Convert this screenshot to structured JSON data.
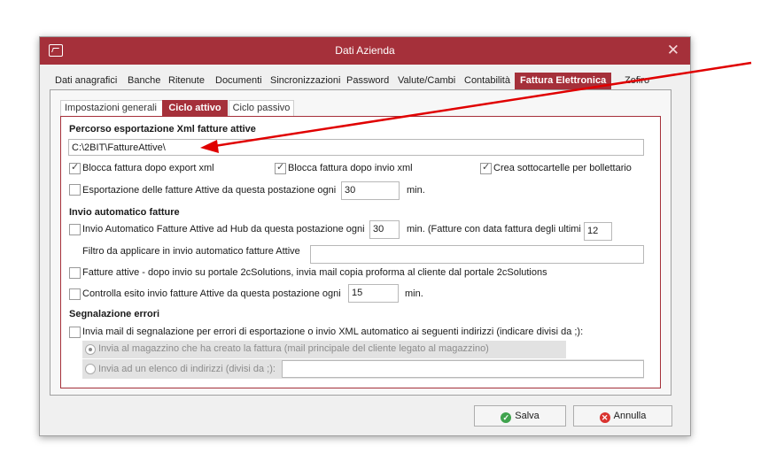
{
  "window": {
    "title": "Dati Azienda",
    "close_glyph": "✕",
    "title_bar_color": "#a5303a"
  },
  "main_tabs": [
    {
      "label": "Dati anagrafici"
    },
    {
      "label": "Banche"
    },
    {
      "label": "Ritenute"
    },
    {
      "label": "Documenti"
    },
    {
      "label": "Sincronizzazioni"
    },
    {
      "label": "Password"
    },
    {
      "label": "Valute/Cambi"
    },
    {
      "label": "Contabilità"
    },
    {
      "label": "Fattura Elettronica"
    },
    {
      "label": "Zefiro"
    }
  ],
  "sub_tabs": [
    {
      "label": "Impostazioni generali"
    },
    {
      "label": "Ciclo attivo"
    },
    {
      "label": "Ciclo passivo"
    }
  ],
  "export": {
    "header": "Percorso esportazione Xml fatture attive",
    "path_value": "C:\\2BIT\\FattureAttive\\",
    "blocca_export_label": "Blocca fattura dopo export xml",
    "blocca_invio_label": "Blocca fattura dopo invio xml",
    "sottocartelle_label": "Crea sottocartelle per bollettario",
    "esportazione_label": "Esportazione delle fatture Attive da questa postazione ogni",
    "esportazione_minutes": "30",
    "min_label": "min."
  },
  "auto_send": {
    "header": "Invio automatico fatture",
    "hub_label": "Invio Automatico Fatture Attive ad Hub da questa postazione ogni",
    "hub_minutes": "30",
    "hub_suffix": "min. (Fatture con data fattura degli ultimi",
    "hub_days": "12",
    "filter_label": "Filtro da applicare in invio automatico fatture Attive",
    "filter_value": "",
    "portal_label": "Fatture attive - dopo invio su portale 2cSolutions, invia mail copia proforma al cliente dal portale 2cSolutions",
    "controlla_label": "Controlla esito invio fatture Attive da questa postazione ogni",
    "controlla_minutes": "15",
    "min_label": "min."
  },
  "errors": {
    "header": "Segnalazione errori",
    "mail_label": "Invia mail di segnalazione per errori di esportazione o invio XML automatico ai seguenti indirizzi (indicare divisi da ;):",
    "radio_magazzino_label": "Invia al magazzino che ha creato la fattura (mail principale del cliente legato al magazzino)",
    "radio_elenco_label": "Invia ad un elenco di indirizzi (divisi da ;):",
    "elenco_value": ""
  },
  "buttons": {
    "save": "Salva",
    "cancel": "Annulla"
  },
  "annotation": {
    "arrow_color": "#e00000"
  }
}
